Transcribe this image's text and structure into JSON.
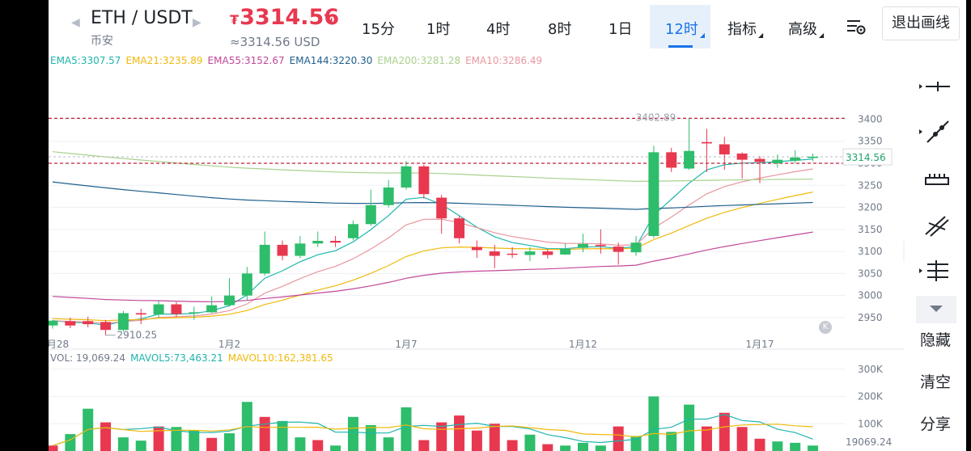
{
  "header": {
    "pair": "ETH / USDT",
    "exchange": "币安",
    "price_symbol": "₮",
    "price": "3314.56",
    "price_usd": "≈3314.56 USD",
    "timeframes": [
      "15分",
      "1时",
      "4时",
      "8时",
      "1日",
      "12时"
    ],
    "active_timeframe": "12时",
    "indicator_label": "指标",
    "advanced_label": "高级",
    "exit_button": "退出画线"
  },
  "ema_legend": [
    {
      "text": "EMA5:3307.57",
      "color": "#1fb5ad"
    },
    {
      "text": "EMA21:3235.89",
      "color": "#f0b90b"
    },
    {
      "text": "EMA55:3152.67",
      "color": "#c2479a"
    },
    {
      "text": "EMA144:3220.30",
      "color": "#1e5f8c"
    },
    {
      "text": "EMA200:3281.28",
      "color": "#a9d18e"
    },
    {
      "text": "EMA10:3286.49",
      "color": "#e8979e"
    }
  ],
  "vol_legend": [
    {
      "text": "VOL: 19,069.24",
      "color": "#707a8a"
    },
    {
      "text": "MAVOL5:73,463.21",
      "color": "#1fb5ad"
    },
    {
      "text": "MAVOL10:162,381.65",
      "color": "#f0b90b"
    }
  ],
  "colors": {
    "up": "#2ebd6b",
    "down": "#e8384f",
    "grid": "#eef0f3",
    "axis_text": "#707a8a",
    "accent": "#1a73e8"
  },
  "toolbar": {
    "tools": [
      "horizontal-line-icon",
      "trend-line-icon",
      "ruler-icon",
      "parallel-channel-icon",
      "fib-icon",
      "collapse-icon"
    ],
    "hide_label": "隐藏",
    "clear_label": "清空",
    "share_label": "分享"
  },
  "k_badge": "K",
  "chart_data": {
    "type": "candlestick",
    "y_ticks": [
      3400,
      3350,
      3300,
      3250,
      3200,
      3150,
      3100,
      3050,
      3000,
      2950
    ],
    "ylim": [
      2915,
      3465
    ],
    "x_labels": [
      "月28",
      "1月2",
      "1月7",
      "1月12",
      "1月17"
    ],
    "high_label": "3402.89",
    "low_label": "2910.25",
    "current_price_label": "3314.56",
    "dashed_levels": [
      3402,
      3300
    ],
    "candles": [
      [
        2932,
        2943,
        2925,
        2945
      ],
      [
        2942,
        2932,
        2926,
        2950
      ],
      [
        2942,
        2935,
        2928,
        2952
      ],
      [
        2940,
        2922,
        2910,
        2945
      ],
      [
        2922,
        2960,
        2918,
        2965
      ],
      [
        2960,
        2957,
        2935,
        2970
      ],
      [
        2957,
        2980,
        2950,
        2988
      ],
      [
        2980,
        2958,
        2952,
        2985
      ],
      [
        2960,
        2962,
        2945,
        2975
      ],
      [
        2962,
        2978,
        2960,
        2998
      ],
      [
        2978,
        3000,
        2975,
        3040
      ],
      [
        3000,
        3050,
        2990,
        3065
      ],
      [
        3050,
        3115,
        3045,
        3145
      ],
      [
        3115,
        3090,
        3080,
        3125
      ],
      [
        3090,
        3118,
        3085,
        3135
      ],
      [
        3118,
        3124,
        3110,
        3145
      ],
      [
        3124,
        3120,
        3110,
        3135
      ],
      [
        3130,
        3162,
        3125,
        3170
      ],
      [
        3162,
        3205,
        3158,
        3240
      ],
      [
        3205,
        3245,
        3200,
        3262
      ],
      [
        3245,
        3293,
        3240,
        3305
      ],
      [
        3293,
        3230,
        3220,
        3297
      ],
      [
        3222,
        3175,
        3140,
        3228
      ],
      [
        3175,
        3130,
        3118,
        3180
      ],
      [
        3110,
        3103,
        3085,
        3125
      ],
      [
        3100,
        3090,
        3062,
        3115
      ],
      [
        3095,
        3094,
        3085,
        3110
      ],
      [
        3092,
        3100,
        3078,
        3110
      ],
      [
        3100,
        3092,
        3084,
        3105
      ],
      [
        3093,
        3106,
        3092,
        3118
      ],
      [
        3108,
        3117,
        3098,
        3140
      ],
      [
        3115,
        3113,
        3095,
        3150
      ],
      [
        3111,
        3099,
        3070,
        3120
      ],
      [
        3098,
        3120,
        3090,
        3135
      ],
      [
        3135,
        3325,
        3130,
        3340
      ],
      [
        3325,
        3290,
        3280,
        3335
      ],
      [
        3288,
        3328,
        3285,
        3402
      ],
      [
        3348,
        3345,
        3280,
        3378
      ],
      [
        3343,
        3320,
        3285,
        3360
      ],
      [
        3322,
        3308,
        3265,
        3325
      ],
      [
        3310,
        3303,
        3255,
        3316
      ],
      [
        3300,
        3308,
        3290,
        3320
      ],
      [
        3306,
        3313,
        3300,
        3330
      ],
      [
        3312,
        3315,
        3305,
        3322
      ]
    ],
    "volume": [
      [
        20,
        "down"
      ],
      [
        62,
        "up"
      ],
      [
        155,
        "up"
      ],
      [
        105,
        "down"
      ],
      [
        50,
        "up"
      ],
      [
        38,
        "up"
      ],
      [
        90,
        "down"
      ],
      [
        88,
        "up"
      ],
      [
        75,
        "up"
      ],
      [
        48,
        "down"
      ],
      [
        65,
        "up"
      ],
      [
        180,
        "up"
      ],
      [
        125,
        "down"
      ],
      [
        110,
        "up"
      ],
      [
        50,
        "up"
      ],
      [
        40,
        "down"
      ],
      [
        20,
        "up"
      ],
      [
        125,
        "up"
      ],
      [
        95,
        "up"
      ],
      [
        50,
        "up"
      ],
      [
        160,
        "up"
      ],
      [
        40,
        "down"
      ],
      [
        105,
        "down"
      ],
      [
        130,
        "down"
      ],
      [
        75,
        "down"
      ],
      [
        100,
        "down"
      ],
      [
        40,
        "down"
      ],
      [
        60,
        "up"
      ],
      [
        25,
        "down"
      ],
      [
        20,
        "up"
      ],
      [
        30,
        "up"
      ],
      [
        20,
        "up"
      ],
      [
        90,
        "down"
      ],
      [
        55,
        "up"
      ],
      [
        200,
        "up"
      ],
      [
        70,
        "up"
      ],
      [
        170,
        "up"
      ],
      [
        90,
        "down"
      ],
      [
        140,
        "down"
      ],
      [
        88,
        "down"
      ],
      [
        45,
        "down"
      ],
      [
        35,
        "up"
      ],
      [
        30,
        "up"
      ],
      [
        20,
        "up"
      ]
    ],
    "volume_ticks": [
      "300K",
      "200K",
      "100K"
    ],
    "volume_current_label": "19069.24"
  }
}
